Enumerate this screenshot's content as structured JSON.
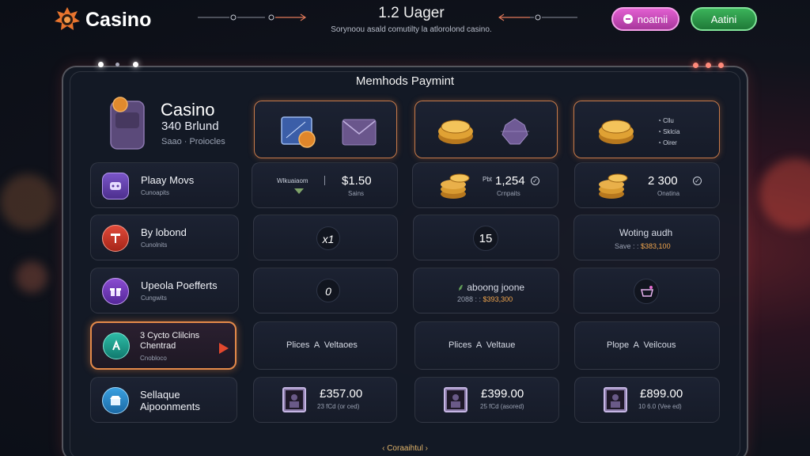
{
  "header": {
    "brand": "Casino",
    "title": "1.2 Uager",
    "subtitle": "Sorynoou asald comutilty la atlorolond casino.",
    "signin_label": "noatnii",
    "activate_label": "Aatini"
  },
  "panel": {
    "title": "Memhods Paymint"
  },
  "profile": {
    "name": "Casino",
    "balance": "340 Brlund",
    "meta": "Saao · Proiocles"
  },
  "top_cards": {
    "right_lines": [
      "Cllu",
      "Sklcia",
      "Oirer"
    ]
  },
  "rows": [
    {
      "title": "Plaay Movs",
      "sub": "Cunoapits",
      "c1_label": "Wlkuaiaom",
      "c1_value": "$1.50",
      "c1_sub": "Sains",
      "c2_prefix": "Pbt",
      "c2_value": "1,254",
      "c2_sub": "Crnpaits",
      "c3_value": "2 300",
      "c3_sub": "Onatina"
    },
    {
      "title": "By lobond",
      "sub": "Cunolnits",
      "c1_value": "x1",
      "c2_value": "15",
      "c3_title": "Woting audh",
      "c3_sub_prefix": "Save : :",
      "c3_sub_value": "$383,100"
    },
    {
      "title": "Upeola Poefferts",
      "sub": "Cungwits",
      "c1_value": "0",
      "c2_title": "aboong joone",
      "c2_sub_prefix": "2088 : :",
      "c2_sub_value": "$393,300"
    },
    {
      "title_line1": "3 Cycto Clilcins",
      "title_line2": "Chentrad",
      "sub": "Cnobloco",
      "c1_label": "Plices  A  Veltaoes",
      "c2_label": "Plices  A  Veltaue",
      "c3_label": "Plope  A  Veilcous"
    },
    {
      "title_line1": "Sellaque",
      "title_line2": "Aipoonments",
      "c1_value": "£357.00",
      "c1_sub": "23 fCd (or ced)",
      "c2_value": "£399.00",
      "c2_sub": "25 fCd (asored)",
      "c3_value": "£899.00",
      "c3_sub": "10 6.0 (Vee ed)"
    }
  ],
  "footer": {
    "link": "Coraaihtul"
  },
  "colors": {
    "accent_orange": "#e58a4a",
    "sign_pink": "#d14fc4",
    "activate_green": "#2f9a4a",
    "panel_bg": "#161b28"
  }
}
